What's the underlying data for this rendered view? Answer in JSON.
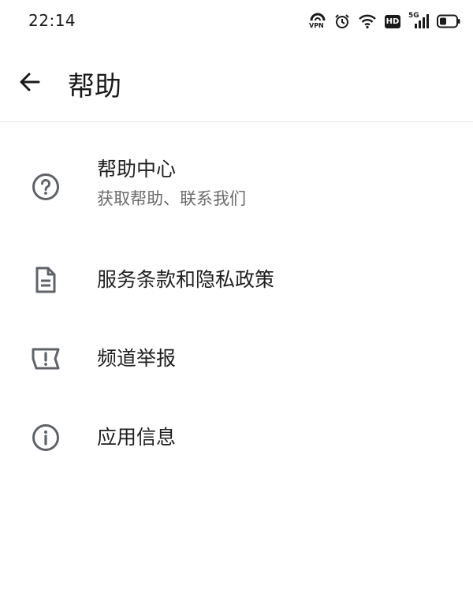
{
  "status_bar": {
    "time": "22:14",
    "icons": [
      "vpn-icon",
      "alarm-icon",
      "wifi-icon",
      "hd-icon",
      "signal-5g-icon",
      "battery-icon"
    ],
    "hd_label": "HD",
    "network_label": "5G",
    "vpn_label": "VPN"
  },
  "app_bar": {
    "back_icon": "arrow-left-icon",
    "title": "帮助"
  },
  "menu": {
    "items": [
      {
        "icon": "help-circle-icon",
        "title": "帮助中心",
        "subtitle": "获取帮助、联系我们"
      },
      {
        "icon": "document-icon",
        "title": "服务条款和隐私政策"
      },
      {
        "icon": "report-flag-icon",
        "title": "频道举报"
      },
      {
        "icon": "info-circle-icon",
        "title": "应用信息"
      }
    ]
  },
  "colors": {
    "background": "#ffffff",
    "primary_text": "#1f1f1f",
    "secondary_text": "#6b6b6b",
    "icon": "#5f6368",
    "divider": "#e6e6e6"
  }
}
